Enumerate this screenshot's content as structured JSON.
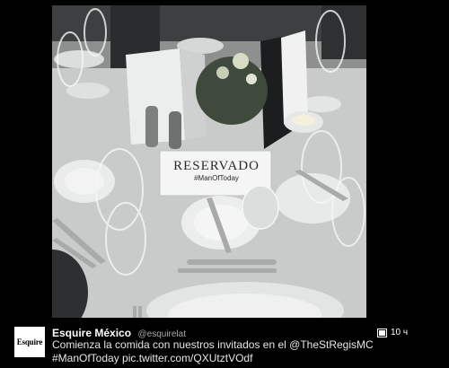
{
  "photo": {
    "card": {
      "title": "RESERVADO",
      "hashtag": "#ManOfToday"
    }
  },
  "tweet": {
    "avatar_logo_text": "Esquire",
    "display_name": "Esquire México",
    "username": "@esquirelat",
    "text_line_1": "Comienza la comida con nuestros invitados en el @TheStRegisMC",
    "text_line_2": "#ManOfToday pic.twitter.com/QXUtztVOdf",
    "timestamp": "10 ч",
    "media_icon": "photo-icon"
  }
}
